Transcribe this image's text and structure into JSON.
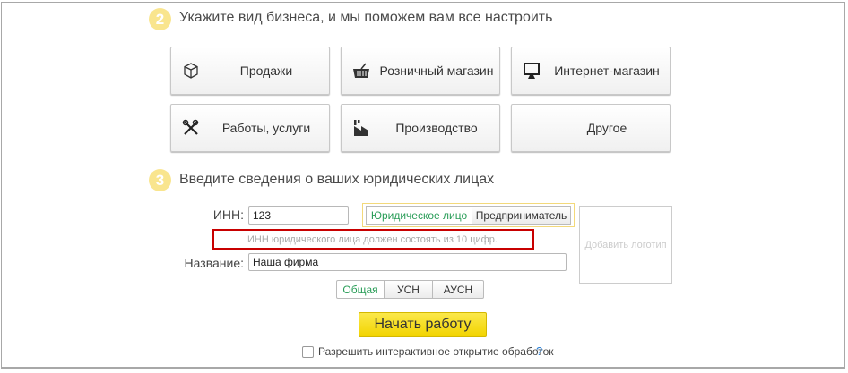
{
  "step2": {
    "number": "2",
    "title": "Укажите вид бизнеса, и мы поможем вам все настроить",
    "business_types": [
      {
        "label": "Продажи",
        "icon": "box-icon"
      },
      {
        "label": "Розничный магазин",
        "icon": "basket-icon"
      },
      {
        "label": "Интернет-магазин",
        "icon": "monitor-icon"
      },
      {
        "label": "Работы, услуги",
        "icon": "tools-icon"
      },
      {
        "label": "Производство",
        "icon": "factory-icon"
      },
      {
        "label": "Другое",
        "icon": ""
      }
    ]
  },
  "step3": {
    "number": "3",
    "title": "Введите сведения о ваших юридических лицах",
    "inn_label": "ИНН:",
    "inn_value": "123",
    "entity_types": [
      {
        "label": "Юридическое лицо",
        "selected": true
      },
      {
        "label": "Предприниматель",
        "selected": false
      }
    ],
    "inn_error": "ИНН юридического лица должен состоять из 10 цифр.",
    "name_label": "Название:",
    "name_value": "Наша фирма",
    "tax_systems": [
      {
        "label": "Общая",
        "selected": true
      },
      {
        "label": "УСН",
        "selected": false
      },
      {
        "label": "АУСН",
        "selected": false
      }
    ],
    "logo_label": "Добавить логотип",
    "start_button": "Начать работу",
    "interactive_checkbox": {
      "label": "Разрешить интерактивное открытие обработок",
      "checked": false,
      "help": "?"
    }
  },
  "colors": {
    "accent_yellow": "#f5d90a",
    "step_circle": "#f9e58e",
    "selected_green": "#2a9d58",
    "error_outline": "#c80000",
    "help_blue": "#2b7fd4"
  }
}
